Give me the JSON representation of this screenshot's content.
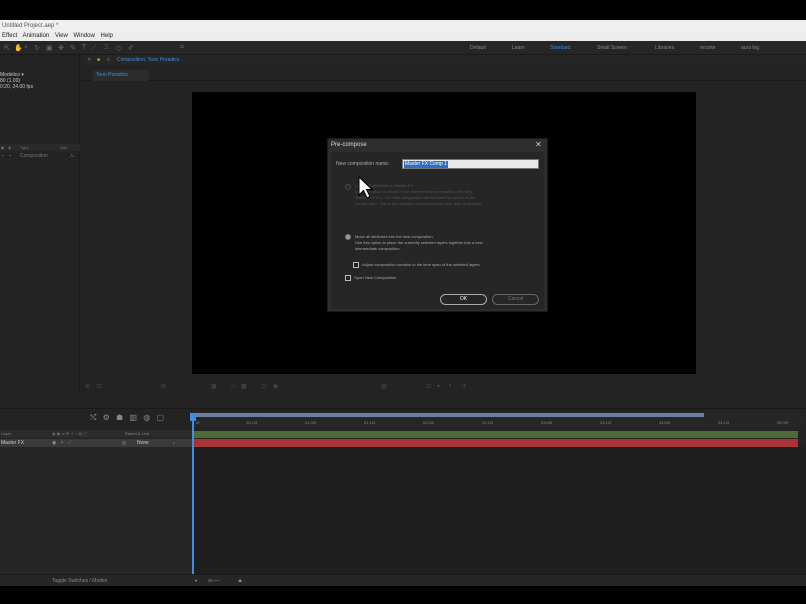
{
  "window": {
    "title": "Untitled Project.aep *"
  },
  "menu": [
    "Effect",
    "Animation",
    "View",
    "Window",
    "Help"
  ],
  "workspaces": [
    "Default",
    "Learn",
    "Standard",
    "Small Screen",
    "Libraries",
    "recorte",
    "aura log"
  ],
  "workspace_active": "Standard",
  "project": {
    "comp_name": "Modelico ▾",
    "comp_line2": "80 (1.00)",
    "comp_line3": "0:20, 24.00 fps",
    "col_type": "Type",
    "col_size": "Size",
    "row_label": "Composition"
  },
  "viewer": {
    "comp_tab": "Composition: Toon Poradico",
    "tab": "Toon Poradico"
  },
  "timeline": {
    "ticks": [
      "0f",
      "00:12f",
      "01:00f",
      "01:12f",
      "02:00f",
      "02:12f",
      "03:00f",
      "03:12f",
      "04:00f",
      "04:12f",
      "05:00f"
    ],
    "layer_header_left": "Layer",
    "layer_header_parent": "Parent & Link",
    "layer_name": "Master FX",
    "parent_value": "None",
    "footer_label": "Toggle Switches / Modes"
  },
  "dialog": {
    "title": "Pre-compose",
    "close": "✕",
    "name_label": "New composition name:",
    "name_value": "Master FX Comp 1",
    "option1_title": "Leave all attributes in 'Master FX'",
    "option1_desc_1": "Use this option to create a new intermediate composition with only",
    "option1_desc_2": "'Master FX' in it. The new composition will become the source to the",
    "option1_desc_3": "current layer. This is not available when more than one layer is selected.",
    "option2_title": "Move all attributes into the new composition",
    "option2_desc_1": "Use this option to place the currently selected layers together into a new",
    "option2_desc_2": "intermediate composition.",
    "adjust_label": "Adjust composition duration to the time span of the selected layers",
    "open_label": "Open New Composition",
    "ok_label": "OK",
    "cancel_label": "Cancel"
  },
  "colors": {
    "accent": "#3d8fe0",
    "track_green": "#4f6b3a",
    "track_red": "#a83434"
  }
}
